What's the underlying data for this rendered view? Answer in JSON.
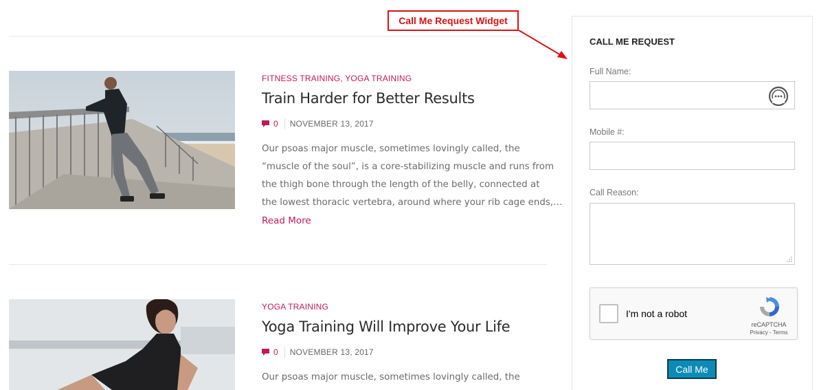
{
  "posts": [
    {
      "categories": [
        "FITNESS TRAINING",
        "YOGA TRAINING"
      ],
      "category_separator": ",",
      "title": "Train Harder for Better Results",
      "comments": "0",
      "date": "NOVEMBER 13, 2017",
      "excerpt_lines": [
        "Our psoas major muscle, sometimes lovingly called, the",
        "“muscle of the soul”, is a core-stabilizing muscle and runs from",
        "the thigh bone through the length of the belly, connected at",
        "the lowest thoracic vertebra, around where your rib cage ends,…"
      ],
      "read_more": "Read More"
    },
    {
      "categories": [
        "YOGA TRAINING"
      ],
      "title": "Yoga Training Will Improve Your Life",
      "comments": "0",
      "date": "NOVEMBER 13, 2017",
      "excerpt_lines": [
        "Our psoas major muscle, sometimes lovingly called, the"
      ]
    }
  ],
  "annotation": {
    "label": "Call Me Request Widget"
  },
  "widget": {
    "title": "CALL ME REQUEST",
    "full_name_label": "Full Name:",
    "mobile_label": "Mobile #:",
    "reason_label": "Call Reason:",
    "recaptcha": {
      "checkbox_label": "I'm not a robot",
      "brand": "reCAPTCHA",
      "links": "Privacy - Terms"
    },
    "submit_label": "Call Me"
  },
  "colors": {
    "accent": "#c2185b",
    "annotation": "#dd1111",
    "button": "#0d8bb7"
  }
}
